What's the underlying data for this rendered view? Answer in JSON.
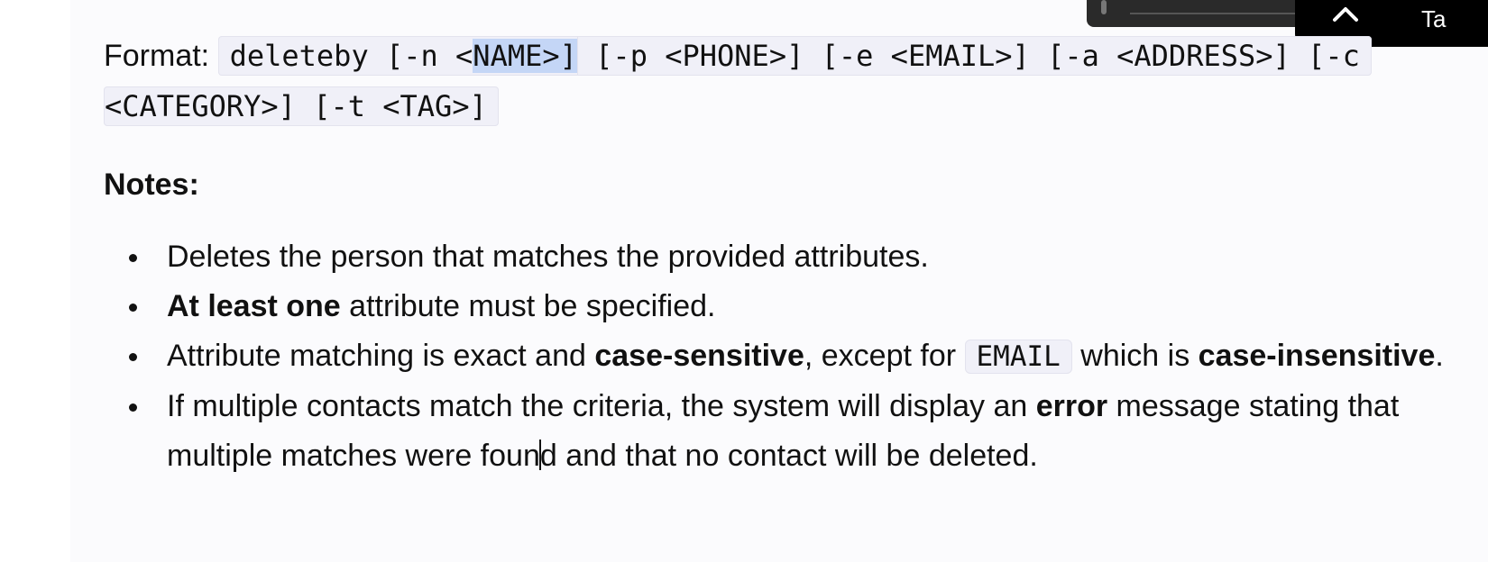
{
  "format": {
    "label": "Format:",
    "code_pre": "deleteby [-n <",
    "code_selected": "NAME>]",
    "code_post": " [-p <PHONE>] [-e <EMAIL>] [-a <ADDRESS>] [-c",
    "code_line2": "<CATEGORY>] [-t <TAG>]"
  },
  "notes": {
    "heading": "Notes:",
    "item1": "Deletes the person that matches the provided attributes.",
    "item2_bold": "At least one",
    "item2_rest": " attribute must be specified.",
    "item3_a": "Attribute matching is exact and ",
    "item3_b_bold": "case-sensitive",
    "item3_c": ", except for ",
    "item3_code": "EMAIL",
    "item3_d": " which is ",
    "item3_e_bold": "case-insensitive",
    "item3_f": ".",
    "item4_a": "If multiple contacts match the criteria, the system will display an ",
    "item4_b_bold": "error",
    "item4_c": " message stating that multiple matches were foun",
    "item4_d": "d and that no contact will be deleted."
  },
  "floating": {
    "label": "Ta",
    "icon": "chevron-up-icon"
  }
}
